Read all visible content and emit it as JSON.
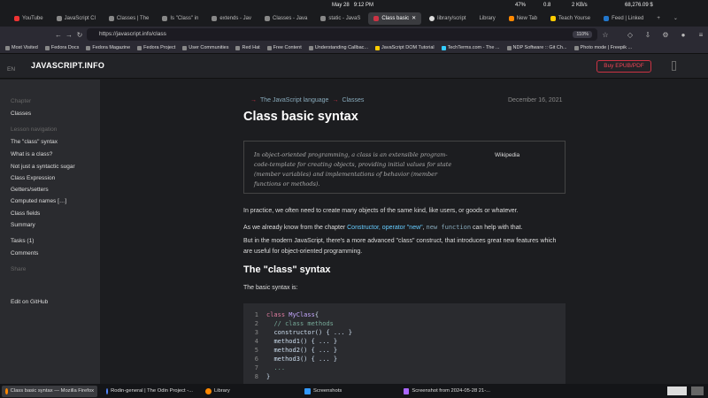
{
  "system": {
    "date": "May 28",
    "time": "9:12 PM",
    "battery": "47%",
    "mem": "0.8",
    "net": "2 KB/s",
    "balance": "68,276.09 $"
  },
  "tabs": [
    {
      "label": "YouTube",
      "color": "#e33"
    },
    {
      "label": "JavaScript Cl",
      "color": "#888"
    },
    {
      "label": "Classes | The",
      "color": "#888"
    },
    {
      "label": "Is \"Class\" in",
      "color": "#888"
    },
    {
      "label": "extends - Jav",
      "color": "#888"
    },
    {
      "label": "Classes - Java",
      "color": "#888"
    },
    {
      "label": "static - JavaS",
      "color": "#888"
    },
    {
      "label": "Class basic",
      "color": "#c34",
      "active": true
    },
    {
      "label": "library/script",
      "color": "#888"
    },
    {
      "label": "Library",
      "color": "#888"
    },
    {
      "label": "New Tab",
      "color": "#f80"
    },
    {
      "label": "Teach Yourse",
      "color": "#fc0"
    },
    {
      "label": "Feed | Linked",
      "color": "#27c"
    }
  ],
  "url": "https://javascript.info/class",
  "zoom": "110%",
  "bookmarks": [
    "Most Visited",
    "Fedora Docs",
    "Fedora Magazine",
    "Fedora Project",
    "User Communities",
    "Red Hat",
    "Free Content",
    "Understanding Callbac...",
    "JavaScript DOM Tutorial",
    "TechTerms.com - The ...",
    "NDP Software :: Git Ch...",
    "Photo mode | Freepik ..."
  ],
  "site": {
    "lang": "EN",
    "logo": "JAVASCRIPT.INFO",
    "buy": "Buy EPUB/PDF"
  },
  "sidebar": {
    "chapter_label": "Chapter",
    "chapter": "Classes",
    "nav_label": "Lesson navigation",
    "items": [
      "The \"class\" syntax",
      "What is a class?",
      "Not just a syntactic sugar",
      "Class Expression",
      "Getters/setters",
      "Computed names […]",
      "Class fields",
      "Summary"
    ],
    "tasks": "Tasks (1)",
    "comments": "Comments",
    "share": "Share",
    "github": "Edit on GitHub"
  },
  "article": {
    "crumb1": "The JavaScript language",
    "crumb2": "Classes",
    "date": "December 16, 2021",
    "title": "Class basic syntax",
    "quote": "In object-oriented programming, a class is an extensible program-code-template for creating objects, providing initial values for state (member variables) and implementations of behavior (member functions or methods).",
    "quote_source": "Wikipedia",
    "p1": "In practice, we often need to create many objects of the same kind, like users, or goods or whatever.",
    "p2_pre": "As we already know from the chapter ",
    "p2_link": "Constructor, operator \"new\"",
    "p2_code": "new function",
    "p2_post": " can help with that.",
    "p3": "But in the modern JavaScript, there's a more advanced \"class\" construct, that introduces great new features which are useful for object-oriented programming.",
    "h2": "The \"class\" syntax",
    "p4": "The basic syntax is:"
  },
  "code": {
    "l1_kw": "class",
    "l1_name": "MyClass",
    "l1_brace": " {",
    "l2": "// class methods",
    "l3": "constructor() { ... }",
    "l4": "method1() { ... }",
    "l5": "method2() { ... }",
    "l6": "method3() { ... }",
    "l7": "...",
    "l8": "}"
  },
  "taskbar": [
    {
      "label": "Class basic syntax — Mozilla Firefox",
      "color": "#f80",
      "active": true
    },
    {
      "label": "Rodin-general | The Odin Project -...",
      "color": "#58f"
    },
    {
      "label": "Library",
      "color": "#f80"
    },
    {
      "label": "Screenshots",
      "color": "#39f"
    },
    {
      "label": "Screenshot from 2024-05-28 21-...",
      "color": "#a6f"
    }
  ]
}
